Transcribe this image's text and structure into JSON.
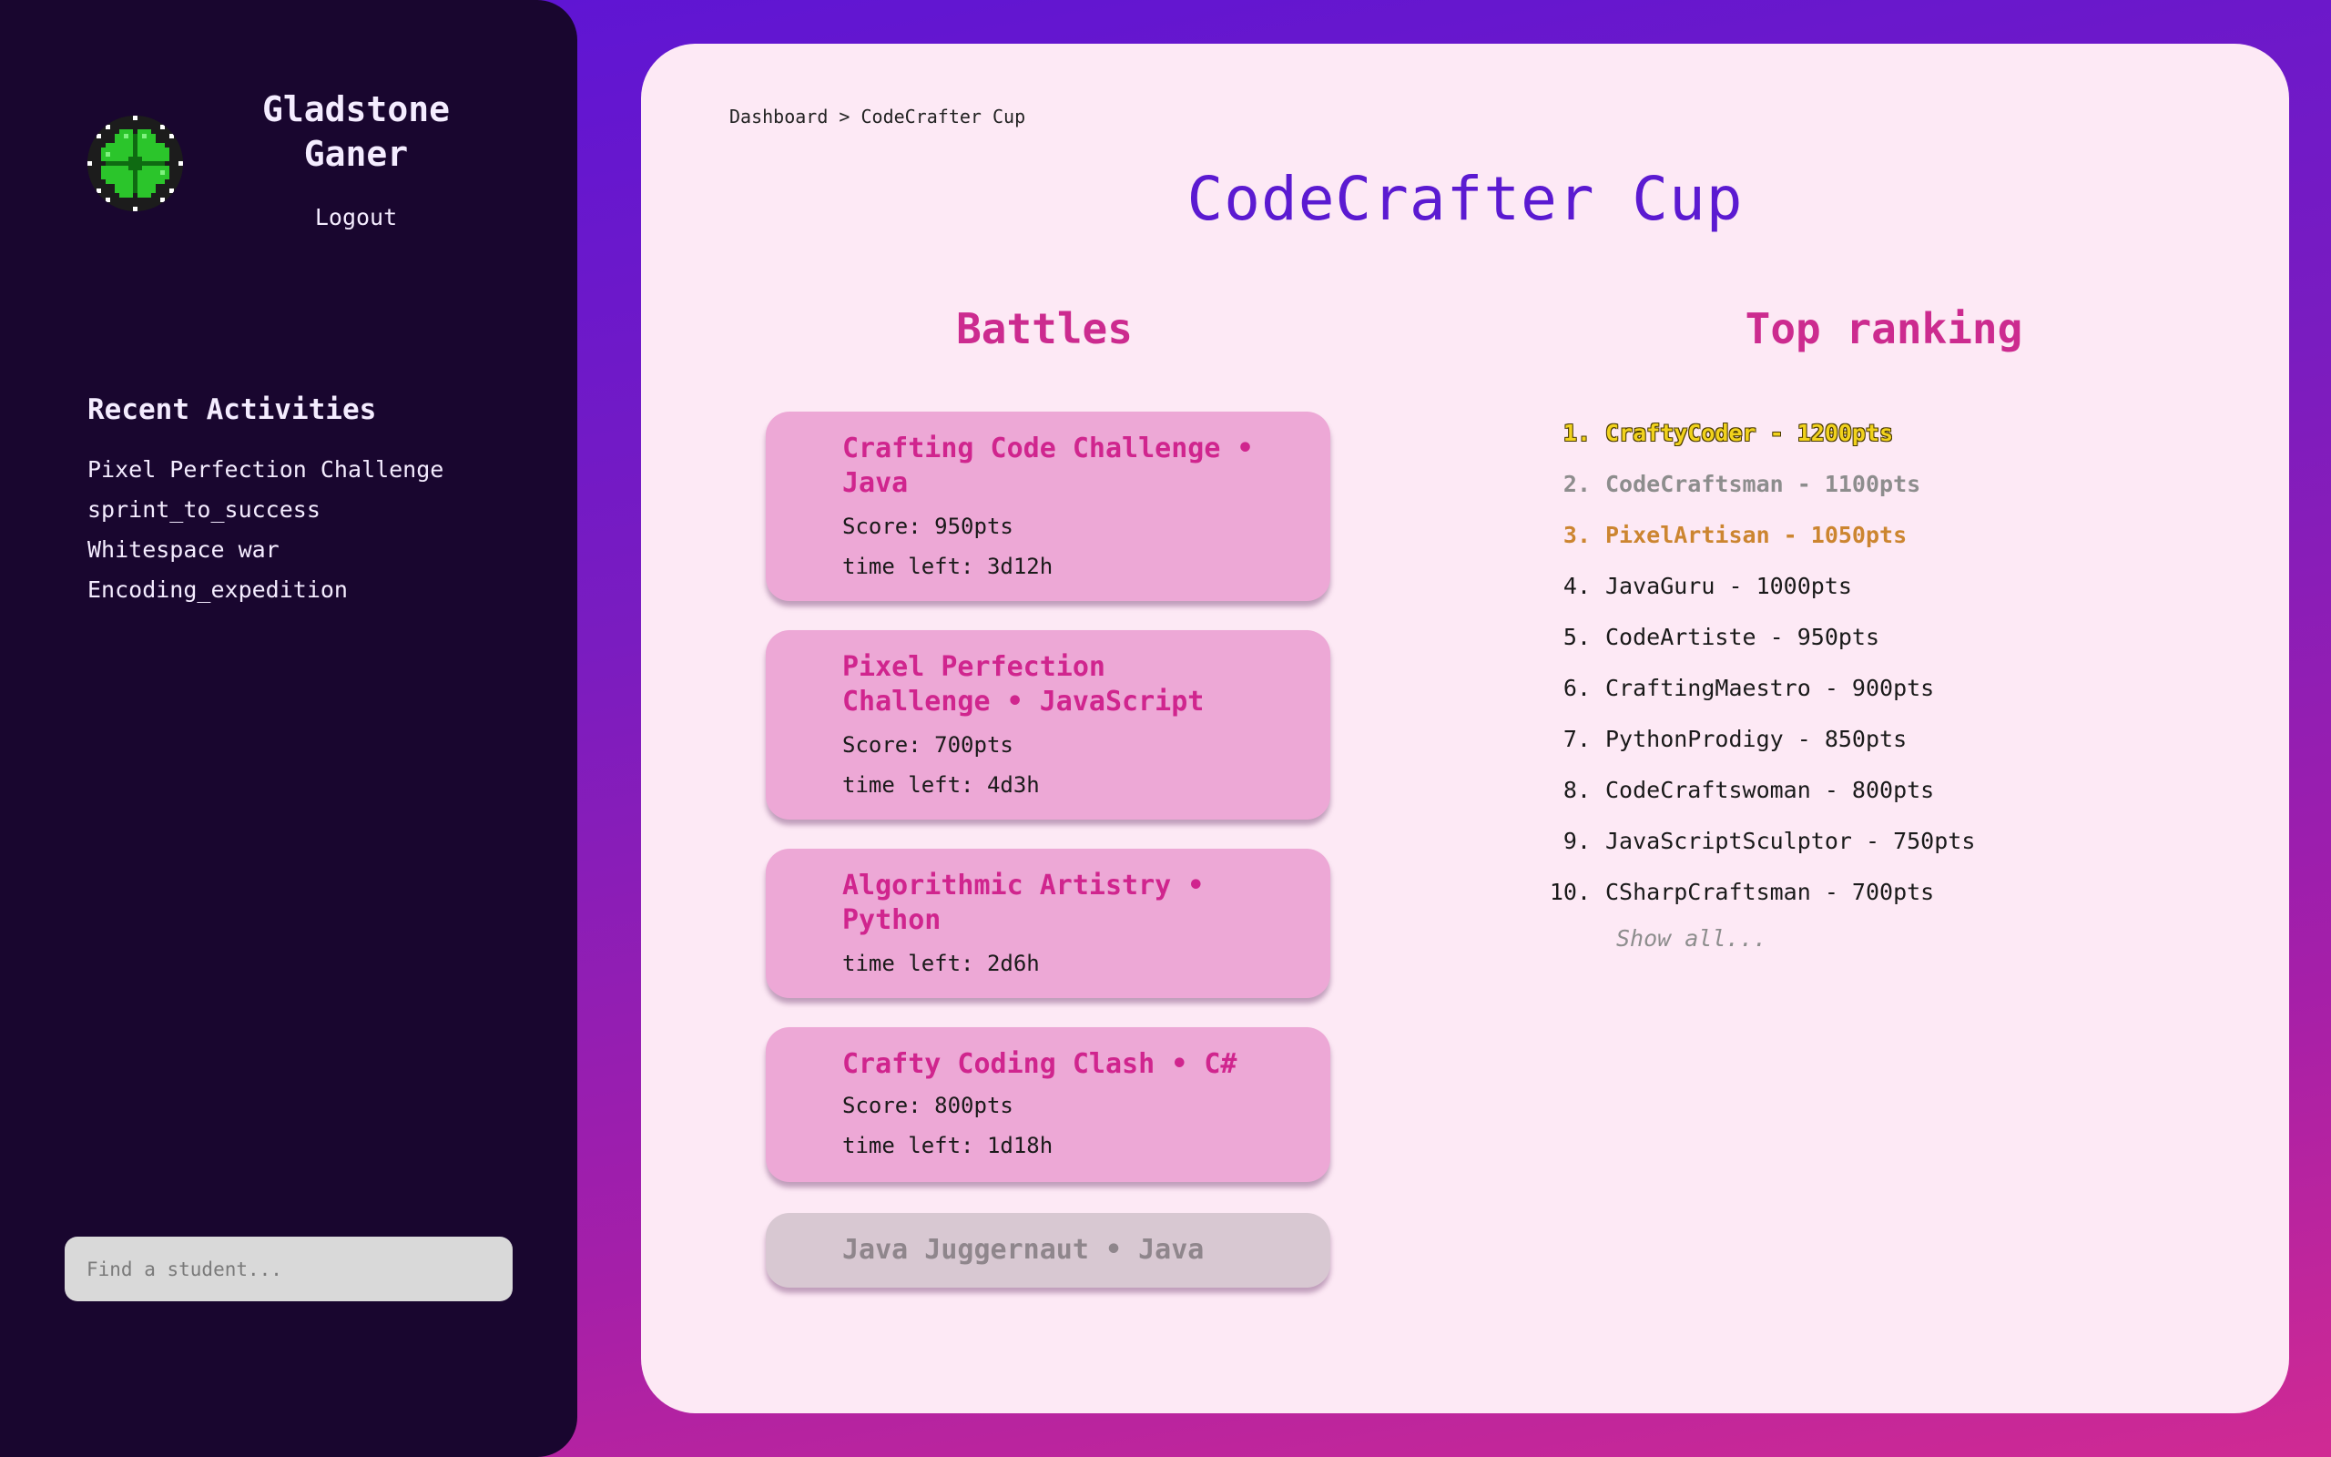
{
  "user": {
    "name": "Gladstone Ganer",
    "avatar_icon": "clover-pixel-icon",
    "logout_label": "Logout"
  },
  "recent_activities": {
    "title": "Recent Activities",
    "items": [
      "Pixel Perfection Challenge",
      "sprint_to_success",
      "Whitespace war",
      "Encoding_expedition"
    ]
  },
  "search": {
    "placeholder": "Find a student..."
  },
  "breadcrumb": {
    "root": "Dashboard",
    "separator": ">",
    "current": "CodeCrafter Cup"
  },
  "page_title": "CodeCrafter Cup",
  "battles": {
    "title": "Battles",
    "items": [
      {
        "title": "Crafting Code Challenge • Java",
        "score": "Score: 950pts",
        "time_left": "time left: 3d12h"
      },
      {
        "title": "Pixel Perfection Challenge • JavaScript",
        "score": "Score: 700pts",
        "time_left": "time left: 4d3h"
      },
      {
        "title": "Algorithmic Artistry • Python",
        "time_left": "time left: 2d6h"
      },
      {
        "title": "Crafty Coding Clash • C#",
        "score": "Score: 800pts",
        "time_left": "time left: 1d18h"
      },
      {
        "title": "Java Juggernaut • Java",
        "disabled": true
      }
    ]
  },
  "ranking": {
    "title": "Top ranking",
    "items": [
      {
        "rank": "1.",
        "text": "CraftyCoder - 1200pts"
      },
      {
        "rank": "2.",
        "text": "CodeCraftsman - 1100pts"
      },
      {
        "rank": "3.",
        "text": "PixelArtisan - 1050pts"
      },
      {
        "rank": "4.",
        "text": "JavaGuru - 1000pts"
      },
      {
        "rank": "5.",
        "text": "CodeArtiste - 950pts"
      },
      {
        "rank": "6.",
        "text": "CraftingMaestro - 900pts"
      },
      {
        "rank": "7.",
        "text": "PythonProdigy - 850pts"
      },
      {
        "rank": "8.",
        "text": "CodeCraftswoman - 800pts"
      },
      {
        "rank": "9.",
        "text": "JavaScriptSculptor - 750pts"
      },
      {
        "rank": "10.",
        "text": "CSharpCraftsman - 700pts"
      }
    ],
    "show_all_label": "Show all..."
  },
  "colors": {
    "sidebar_bg": "#19062f",
    "main_bg": "#fde9f5",
    "title_purple": "#5b1ad1",
    "accent_pink": "#d0258e",
    "card_pink": "#eda8d6",
    "gold": "#f1d21d",
    "silver": "#8d8d8d",
    "bronze": "#cc8530"
  }
}
